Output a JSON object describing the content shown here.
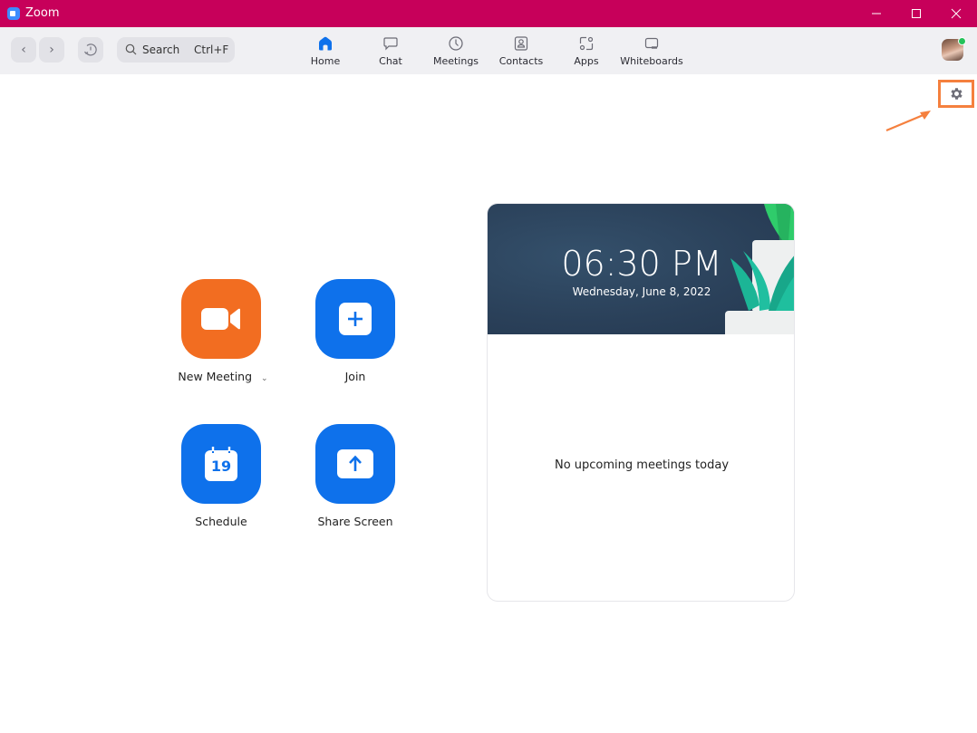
{
  "window": {
    "title": "Zoom",
    "controls": {
      "minimize": "minimize",
      "maximize": "maximize",
      "close": "close"
    }
  },
  "toolbar": {
    "back_icon": "‹",
    "forward_icon": "›",
    "search": {
      "label": "Search",
      "shortcut": "Ctrl+F"
    },
    "tabs": [
      {
        "label": "Home",
        "icon": "home-icon",
        "active": true
      },
      {
        "label": "Chat",
        "icon": "chat-icon",
        "active": false
      },
      {
        "label": "Meetings",
        "icon": "clock-icon",
        "active": false
      },
      {
        "label": "Contacts",
        "icon": "contact-icon",
        "active": false
      },
      {
        "label": "Apps",
        "icon": "apps-icon",
        "active": false
      },
      {
        "label": "Whiteboards",
        "icon": "whiteboard-icon",
        "active": false
      }
    ],
    "avatar_status": "online"
  },
  "actions": [
    {
      "label": "New Meeting",
      "icon": "video-camera-icon",
      "has_dropdown": true,
      "color": "#f26d21"
    },
    {
      "label": "Join",
      "icon": "plus-icon",
      "has_dropdown": false,
      "color": "#0e71eb"
    },
    {
      "label": "Schedule",
      "icon": "calendar-icon",
      "calendar_day": "19",
      "has_dropdown": false,
      "color": "#0e71eb"
    },
    {
      "label": "Share Screen",
      "icon": "share-screen-icon",
      "has_dropdown": false,
      "color": "#0e71eb"
    }
  ],
  "meetings_card": {
    "time": "06:30 PM",
    "date": "Wednesday, June 8, 2022",
    "empty_message": "No upcoming meetings today"
  },
  "annotation": {
    "highlight_color": "#f5803e",
    "target": "settings-gear"
  },
  "colors": {
    "titlebar": "#c7005a",
    "accent": "#0e71eb",
    "toolbar_bg": "#f0f0f3"
  }
}
